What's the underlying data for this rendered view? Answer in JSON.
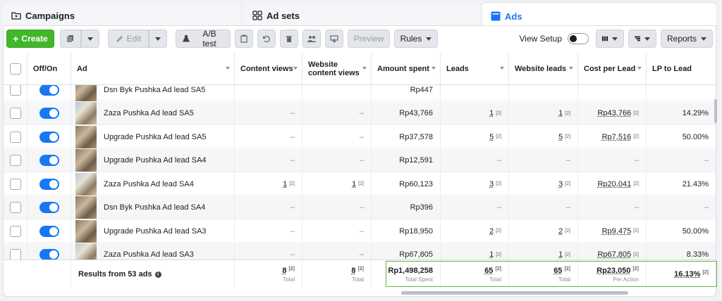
{
  "tabs": [
    {
      "label": "Campaigns",
      "icon": "folder-icon"
    },
    {
      "label": "Ad sets",
      "icon": "grid-icon"
    },
    {
      "label": "Ads",
      "icon": "ad-icon"
    }
  ],
  "toolbar": {
    "create": "Create",
    "edit": "Edit",
    "ab_test": "A/B test",
    "preview": "Preview",
    "rules": "Rules",
    "view_setup": "View Setup",
    "reports": "Reports"
  },
  "columns": [
    "Off/On",
    "Ad",
    "Content views",
    "Website content views",
    "Amount spent",
    "Leads",
    "Website leads",
    "Cost per Lead",
    "LP to Lead"
  ],
  "rows": [
    {
      "ad": "Dsn Byk Pushka Ad lead SA5",
      "content_views": "",
      "website_content_views": "",
      "amount_spent": "Rp447",
      "leads": "",
      "website_leads": "",
      "cost_per_lead": "",
      "lp_to_lead": ""
    },
    {
      "ad": "Zaza Pushka Ad lead SA5",
      "content_views": "–",
      "website_content_views": "–",
      "amount_spent": "Rp43,766",
      "leads": "1",
      "website_leads": "1",
      "cost_per_lead": "Rp43,766",
      "lp_to_lead": "14.29%"
    },
    {
      "ad": "Upgrade Pushka Ad lead SA5",
      "content_views": "–",
      "website_content_views": "–",
      "amount_spent": "Rp37,578",
      "leads": "5",
      "website_leads": "5",
      "cost_per_lead": "Rp7,516",
      "lp_to_lead": "50.00%"
    },
    {
      "ad": "Upgrade Pushka Ad lead SA4",
      "content_views": "–",
      "website_content_views": "–",
      "amount_spent": "Rp12,591",
      "leads": "–",
      "website_leads": "–",
      "cost_per_lead": "–",
      "lp_to_lead": "–"
    },
    {
      "ad": "Zaza Pushka Ad lead SA4",
      "content_views": "1",
      "website_content_views": "1",
      "amount_spent": "Rp60,123",
      "leads": "3",
      "website_leads": "3",
      "cost_per_lead": "Rp20,041",
      "lp_to_lead": "21.43%"
    },
    {
      "ad": "Dsn Byk Pushka Ad lead SA4",
      "content_views": "–",
      "website_content_views": "–",
      "amount_spent": "Rp396",
      "leads": "–",
      "website_leads": "–",
      "cost_per_lead": "–",
      "lp_to_lead": "–"
    },
    {
      "ad": "Upgrade Pushka Ad lead SA3",
      "content_views": "–",
      "website_content_views": "–",
      "amount_spent": "Rp18,950",
      "leads": "2",
      "website_leads": "2",
      "cost_per_lead": "Rp9,475",
      "lp_to_lead": "50.00%"
    },
    {
      "ad": "Zaza Pushka Ad lead SA3",
      "content_views": "–",
      "website_content_views": "–",
      "amount_spent": "Rp67,805",
      "leads": "1",
      "website_leads": "1",
      "cost_per_lead": "Rp67,805",
      "lp_to_lead": "8.33%"
    }
  ],
  "totals": {
    "label": "Results from 53 ads",
    "content_views": "8",
    "content_views_label": "Total",
    "website_content_views": "8",
    "website_content_views_label": "Total",
    "amount_spent": "Rp1,498,258",
    "amount_spent_label": "Total Spent",
    "leads": "65",
    "leads_label": "Total",
    "website_leads": "65",
    "website_leads_label": "Total",
    "cost_per_lead": "Rp23,050",
    "cost_per_lead_label": "Per Action",
    "lp_to_lead": "16.13%"
  },
  "colors": {
    "accent": "#1877f2",
    "create": "#42b72a",
    "highlight": "#63b346"
  }
}
